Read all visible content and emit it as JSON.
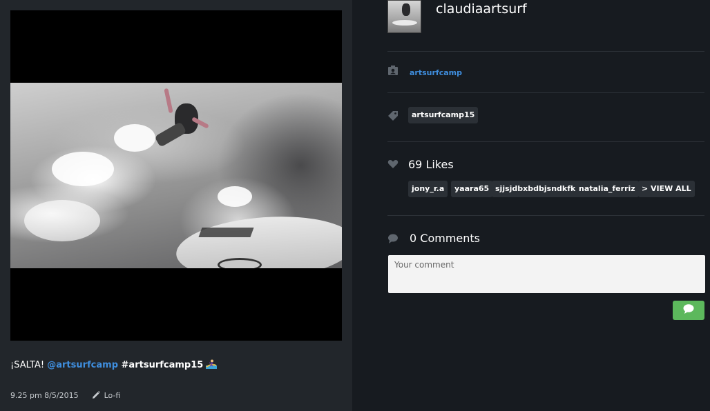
{
  "post": {
    "caption_text": "¡SALTA! ",
    "caption_mention": "@artsurfcamp",
    "caption_hashtag": " #artsurfcamp15",
    "timestamp": "9.25 pm 8/5/2015",
    "filter_label": "Lo-fi"
  },
  "profile": {
    "username": "claudiaartsurf"
  },
  "location": {
    "icon": "contact-card-icon",
    "label": "artsurfcamp"
  },
  "tags": {
    "icon": "tag-icon",
    "items": [
      "artsurfcamp15"
    ]
  },
  "likes": {
    "icon": "heart-icon",
    "count_label": "69 Likes",
    "users": [
      "jony_r.a",
      "yaara65",
      "sjjsjdbxbdbjsndkfk",
      "natalia_ferriz"
    ],
    "view_all_label": "> VIEW ALL"
  },
  "comments": {
    "icon": "speech-bubble-icon",
    "count_label": "0 Comments",
    "input_placeholder": "Your comment",
    "send_icon": "chat-bubble-icon"
  },
  "colors": {
    "left_panel": "#22262b",
    "right_panel": "#171b20",
    "link": "#3f8ede",
    "tag_bg": "#2b3036",
    "send_button": "#5cb85c"
  }
}
